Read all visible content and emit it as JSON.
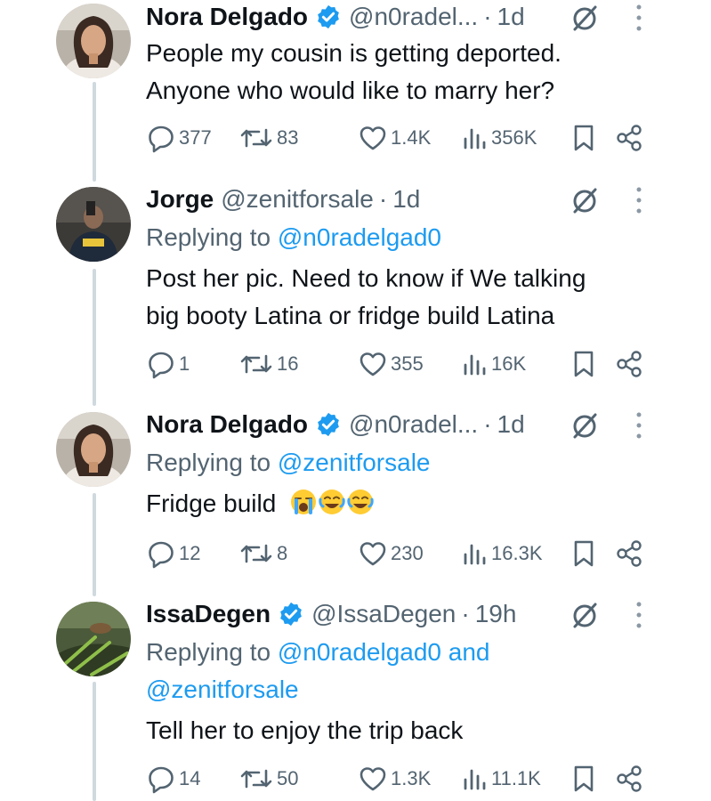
{
  "colors": {
    "text": "#0f1419",
    "muted": "#536471",
    "link": "#1d9bf0",
    "verified": "#1d9bf0",
    "thread": "#cfd9de"
  },
  "tweets": [
    {
      "name": "Nora Delgado",
      "verified": true,
      "handle": "@n0radel...",
      "dot": "·",
      "time": "1d",
      "replying": null,
      "lines": [
        "People my cousin is getting deported.",
        "Anyone who would like to marry her?"
      ],
      "stats": {
        "replies": "377",
        "reposts": "83",
        "likes": "1.4K",
        "views": "356K"
      }
    },
    {
      "name": "Jorge",
      "verified": false,
      "handle": "@zenitforsale",
      "dot": "·",
      "time": "1d",
      "replying": {
        "prefix": "Replying to ",
        "mentions": [
          "@n0radelgad0"
        ]
      },
      "lines": [
        "Post her pic. Need to know if We talking",
        "big booty Latina or fridge build Latina"
      ],
      "stats": {
        "replies": "1",
        "reposts": "16",
        "likes": "355",
        "views": "16K"
      }
    },
    {
      "name": "Nora Delgado",
      "verified": true,
      "handle": "@n0radel...",
      "dot": "·",
      "time": "1d",
      "replying": {
        "prefix": "Replying to ",
        "mentions": [
          "@zenitforsale"
        ]
      },
      "lines": [
        "Fridge build"
      ],
      "emojis": [
        "loudly-crying-face",
        "tears-of-joy-face",
        "tears-of-joy-face"
      ],
      "stats": {
        "replies": "12",
        "reposts": "8",
        "likes": "230",
        "views": "16.3K"
      }
    },
    {
      "name": "IssaDegen",
      "verified": true,
      "handle": "@IssaDegen",
      "dot": "·",
      "time": "19h",
      "replying": {
        "prefix": "Replying to ",
        "mentions": [
          "@n0radelgad0 and",
          "@zenitforsale"
        ]
      },
      "lines": [
        "Tell her to enjoy the trip back"
      ],
      "stats": {
        "replies": "14",
        "reposts": "50",
        "likes": "1.3K",
        "views": "11.1K"
      }
    }
  ],
  "icons": [
    "reply-icon",
    "repost-icon",
    "like-icon",
    "views-icon",
    "bookmark-icon",
    "share-icon",
    "grok-icon",
    "more-icon",
    "verified-badge-icon"
  ]
}
